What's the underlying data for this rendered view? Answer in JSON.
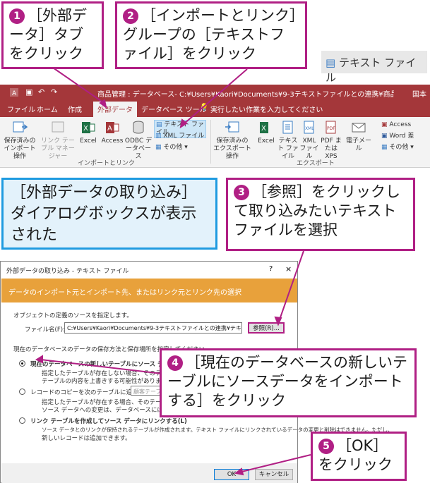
{
  "callouts": {
    "c1": {
      "num": "1",
      "text": "［外部データ］タブをクリック"
    },
    "c2": {
      "num": "2",
      "text": "［インポートとリンク］グループの［テキストファイル］をクリック"
    },
    "c3": {
      "num": "3",
      "text": "［参照］をクリックして取り込みたいテキストファイルを選択"
    },
    "c4": {
      "num": "4",
      "text": "［現在のデータベースの新しいテーブルにソースデータをインポートする］をクリック"
    },
    "c5": {
      "num": "5",
      "text": "［OK］をクリック"
    },
    "info": "［外部データの取り込み］ダイアログボックスが表示された"
  },
  "zoom_button": {
    "label": "テキスト ファイル"
  },
  "window": {
    "title": "商品管理 : データベース- C:¥Users¥Kaori¥Documents¥9-3テキストファイルとの連携¥商品管理.accdb (Access 200...",
    "user_tail": "国本"
  },
  "tabs": [
    "ファイル",
    "ホーム",
    "作成",
    "外部データ",
    "データベース ツール"
  ],
  "tell_me": "実行したい作業を入力してください",
  "ribbon": {
    "import_group": {
      "label": "インポートとリンク",
      "buttons": [
        "保存済みの インポート操作",
        "リンク テーブル マネージャー",
        "Excel",
        "Access",
        "ODBC データベース"
      ],
      "small_buttons": [
        "テキスト ファイル",
        "XML ファイル",
        "その他"
      ]
    },
    "export_group": {
      "label": "エクスポート",
      "buttons": [
        "保存済みの エクスポート操作",
        "Excel",
        "テキスト ファイル",
        "XML ファイル",
        "PDF または XPS",
        "電子メール"
      ],
      "small_buttons": [
        "Access",
        "Word 差",
        "その他"
      ]
    }
  },
  "dialog": {
    "title": "外部データの取り込み - テキスト ファイル",
    "help": "?",
    "close": "×",
    "band": "データのインポート元とインポート先、またはリンク元とリンク先の選択",
    "source_prompt": "オブジェクトの定義のソースを指定します。",
    "filename_label": "ファイル名(F):",
    "filename_value": "C:¥Users¥Kaori¥Documents¥9-3テキストファイルとの連携¥テキストファイル¥3月新商品デー",
    "browse": "参照(R)...",
    "storage_prompt": "現在のデータベースのデータの保存方法と保存場所を指定してください。",
    "opt1": "現在のデータベースの新しいテーブルにソース データをインポートする",
    "opt1_desc1": "指定したテーブルが存在しない場合、そのテーブルが作成されます",
    "opt1_desc2": "テーブルの内容を上書きする可能性があります。ソース データ",
    "opt2": "レコードのコピーを次のテーブルに追加する(A):",
    "opt2_field": "顧客テーブル",
    "opt2_desc1": "指定したテーブルが存在する場合、そのテーブルにレコードが追加され",
    "opt2_desc2": "ソース データへの変更は、データベースには反映されません。",
    "opt3": "リンク テーブルを作成してソース データにリンクする(L)",
    "opt3_desc1": "ソース データとのリンクが保持されるテーブルが作成されます。テキスト ファイルにリンクされているデータの変更と削除はできません。ただし、",
    "opt3_desc2": "新しいレコードは追加できます。",
    "ok": "OK",
    "cancel": "キャンセル"
  }
}
